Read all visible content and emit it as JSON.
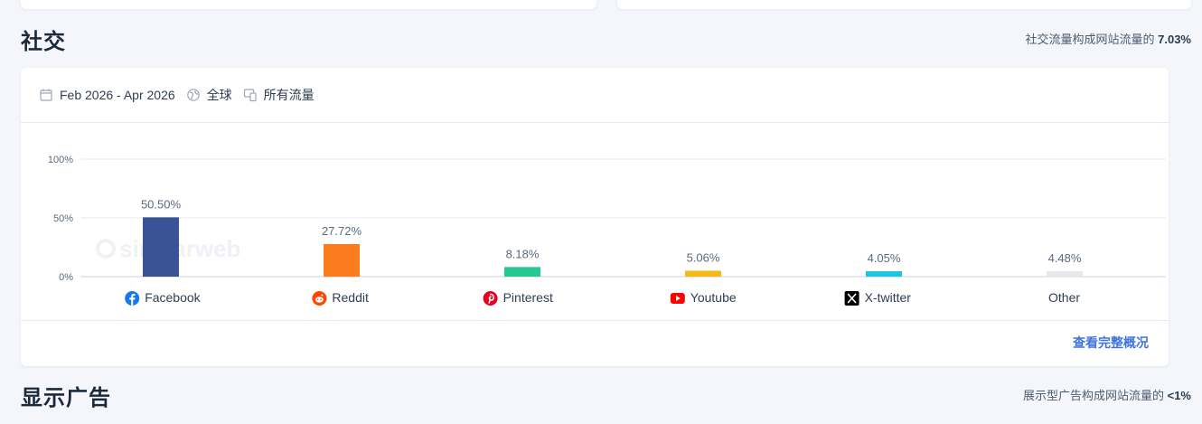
{
  "social": {
    "title": "社交",
    "note_prefix": "社交流量构成网站流量的",
    "note_value": "7.03%"
  },
  "filters": {
    "date_range": "Feb 2026 - Apr 2026",
    "region": "全球",
    "traffic": "所有流量"
  },
  "chart_data": {
    "type": "bar",
    "categories": [
      "Facebook",
      "Reddit",
      "Pinterest",
      "Youtube",
      "X-twitter",
      "Other"
    ],
    "values": [
      50.5,
      27.72,
      8.18,
      5.06,
      4.05,
      4.48
    ],
    "data_labels": [
      "50.50%",
      "27.72%",
      "8.18%",
      "5.06%",
      "4.05%",
      "4.48%"
    ],
    "colors": [
      "#3a5396",
      "#fa7c1d",
      "#26c791",
      "#f6b918",
      "#1ec5e0",
      "#e6e8ec"
    ],
    "icons": [
      "facebook-icon",
      "reddit-icon",
      "pinterest-icon",
      "youtube-icon",
      "x-twitter-icon",
      ""
    ],
    "yticks": [
      "0%",
      "50%",
      "100%"
    ],
    "ylim": [
      0,
      100
    ],
    "watermark": "similarweb",
    "grid": true,
    "title": "",
    "xlabel": "",
    "ylabel": ""
  },
  "footer": {
    "more_link": "查看完整概况"
  },
  "display_ads": {
    "title": "显示广告",
    "note_prefix": "展示型广告构成网站流量的",
    "note_value": "<1%"
  }
}
